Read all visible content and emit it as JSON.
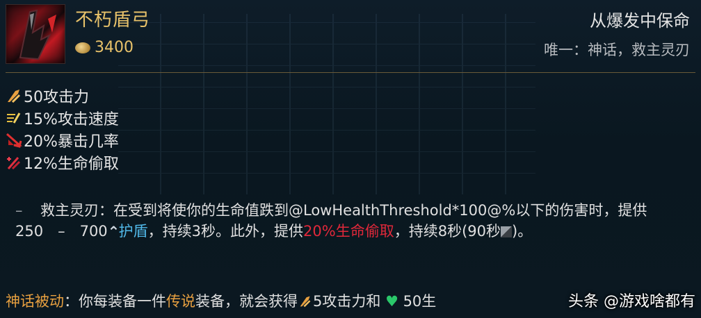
{
  "item": {
    "name": "不朽盾弓",
    "cost": "3400",
    "category": "从爆发中保命",
    "unique": "唯一：神话，救主灵刃"
  },
  "stats": [
    {
      "icon": "attack-damage-icon",
      "text": "50攻击力"
    },
    {
      "icon": "attack-speed-icon",
      "text": "15%攻击速度"
    },
    {
      "icon": "crit-chance-icon",
      "text": "20%暴击几率"
    },
    {
      "icon": "life-steal-icon",
      "text": "12%生命偷取"
    }
  ],
  "passive": {
    "dash": "–",
    "text1": "救主灵刃：在受到将使你的生命值跌到@LowHealthThreshold*100@%以下的伤害时，提供250　–　700",
    "shield": "护盾",
    "text2": "，持续3秒。此外，提供",
    "lifesteal": "20%生命偷取",
    "text3": "，持续8秒(90秒",
    "text4": ")。"
  },
  "mythic": {
    "label": "神话被动",
    "colon": "：你每装备一件",
    "legend": "传说",
    "text1": "装备，就会获得",
    "ad": "5攻击力和",
    "hp": " 50生"
  },
  "watermark": "头条 @游戏啥都有",
  "colors": {
    "gold": "#e8c26a",
    "blue": "#50b8e8",
    "red": "#e0283a",
    "orange": "#e8a040"
  }
}
